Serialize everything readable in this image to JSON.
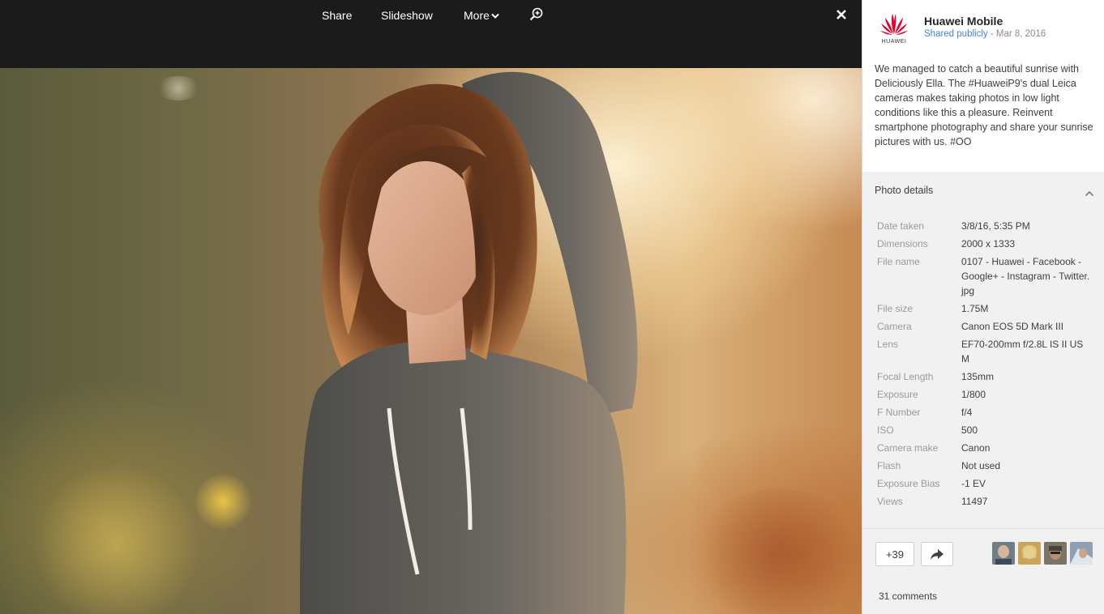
{
  "toolbar": {
    "share_label": "Share",
    "slideshow_label": "Slideshow",
    "more_label": "More"
  },
  "post": {
    "author": "Huawei Mobile",
    "shared_label": "Shared publicly",
    "date": "- Mar 8, 2016",
    "logo_text": "HUAWEI",
    "text": "We managed to catch a beautiful sunrise with Deliciously Ella. The #HuaweiP9's dual Leica cameras makes taking photos in low light conditions like this a pleasure. Reinvent smartphone photography and share your sunrise pictures with us. #OO"
  },
  "details": {
    "title": "Photo details",
    "rows": [
      {
        "label": "Date taken",
        "value": "3/8/16, 5:35 PM"
      },
      {
        "label": "Dimensions",
        "value": "2000 x 1333"
      },
      {
        "label": "File name",
        "value": "0107 - Huawei - Facebook - Google+ - Instagram - Twitter.jpg"
      },
      {
        "label": "File size",
        "value": "1.75M"
      },
      {
        "label": "Camera",
        "value": "Canon EOS 5D Mark III"
      },
      {
        "label": "Lens",
        "value": "EF70-200mm f/2.8L IS II USM"
      },
      {
        "label": "Focal Length",
        "value": "135mm"
      },
      {
        "label": "Exposure",
        "value": "1/800"
      },
      {
        "label": "F Number",
        "value": "f/4"
      },
      {
        "label": "ISO",
        "value": "500"
      },
      {
        "label": "Camera make",
        "value": "Canon"
      },
      {
        "label": "Flash",
        "value": "Not used"
      },
      {
        "label": "Exposure Bias",
        "value": "-1 EV"
      },
      {
        "label": "Views",
        "value": "11497"
      }
    ]
  },
  "actions": {
    "plus_count": "+39",
    "comments": "31 comments"
  },
  "colors": {
    "topbar": "#1b1b1b",
    "link": "#427fed",
    "huawei_red": "#e4002b"
  }
}
